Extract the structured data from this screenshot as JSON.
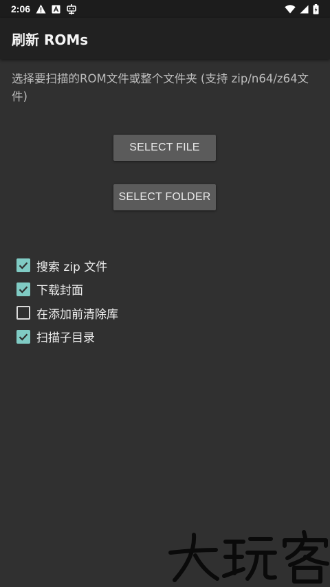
{
  "status_bar": {
    "time": "2:06",
    "left_icons": [
      "warning-icon",
      "a-box-icon",
      "robot-icon"
    ],
    "right_icons": [
      "wifi-icon",
      "signal-icon",
      "battery-icon"
    ]
  },
  "app_bar": {
    "title": "刷新 ROMs"
  },
  "description": "选择要扫描的ROM文件或整个文件夹 (支持 zip/n64/z64文件)",
  "buttons": {
    "select_file": "SELECT FILE",
    "select_folder": "SELECT FOLDER"
  },
  "options": [
    {
      "label": "搜索 zip 文件",
      "checked": true
    },
    {
      "label": "下载封面",
      "checked": true
    },
    {
      "label": "在添加前清除库",
      "checked": false
    },
    {
      "label": "扫描子目录",
      "checked": true
    }
  ],
  "colors": {
    "background": "#303030",
    "app_bar": "#212121",
    "accent": "#80cbc4",
    "button": "#5b5b5b"
  },
  "watermark": "大玩客"
}
